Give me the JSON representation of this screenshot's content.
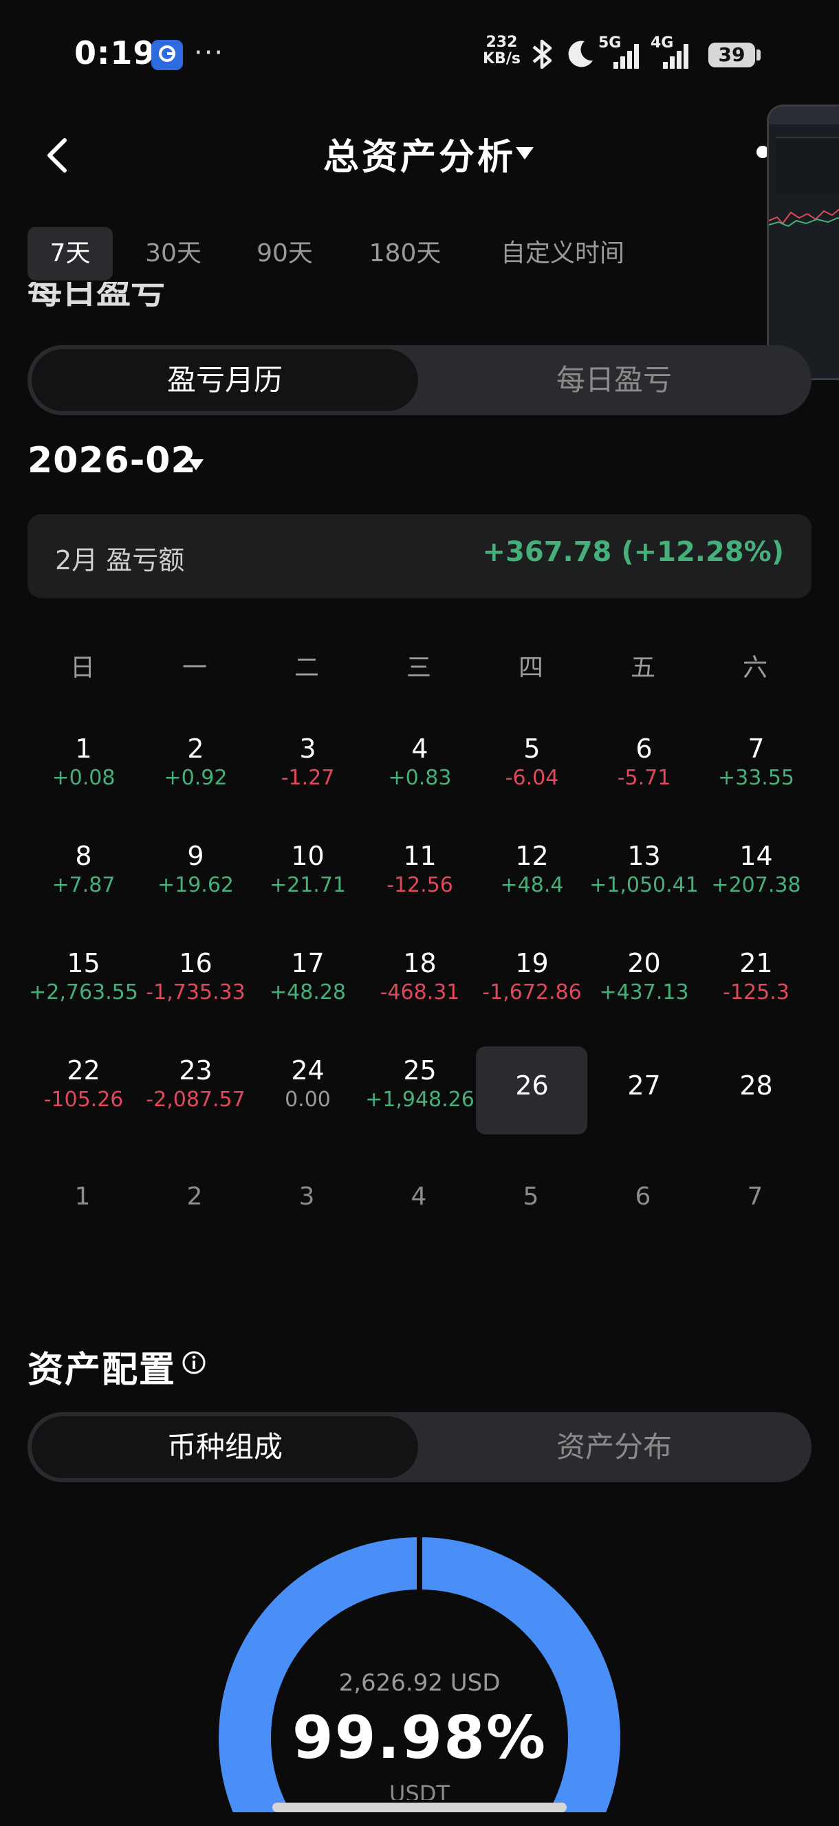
{
  "status_bar": {
    "time": "0:19",
    "more": "···",
    "net_speed_value": "232",
    "net_speed_unit": "KB/s",
    "sig1_label": "5G",
    "sig2_label": "4G",
    "battery": "39"
  },
  "header": {
    "title": "总资产分析"
  },
  "period_tabs": [
    "7天",
    "30天",
    "90天",
    "180天",
    "自定义时间"
  ],
  "daily_pnl_section_title": "每日盈亏",
  "pnl_toggle": {
    "calendar": "盈亏月历",
    "daily": "每日盈亏"
  },
  "month_selector": "2026-02",
  "summary": {
    "label": "2月 盈亏额",
    "value": "+367.78 (+12.28%)"
  },
  "weekdays": [
    "日",
    "一",
    "二",
    "三",
    "四",
    "五",
    "六"
  ],
  "calendar": [
    {
      "day": "1",
      "value": "+0.08",
      "trend": "pos"
    },
    {
      "day": "2",
      "value": "+0.92",
      "trend": "pos"
    },
    {
      "day": "3",
      "value": "-1.27",
      "trend": "neg"
    },
    {
      "day": "4",
      "value": "+0.83",
      "trend": "pos"
    },
    {
      "day": "5",
      "value": "-6.04",
      "trend": "neg"
    },
    {
      "day": "6",
      "value": "-5.71",
      "trend": "neg"
    },
    {
      "day": "7",
      "value": "+33.55",
      "trend": "pos"
    },
    {
      "day": "8",
      "value": "+7.87",
      "trend": "pos"
    },
    {
      "day": "9",
      "value": "+19.62",
      "trend": "pos"
    },
    {
      "day": "10",
      "value": "+21.71",
      "trend": "pos"
    },
    {
      "day": "11",
      "value": "-12.56",
      "trend": "neg"
    },
    {
      "day": "12",
      "value": "+48.4",
      "trend": "pos"
    },
    {
      "day": "13",
      "value": "+1,050.41",
      "trend": "pos"
    },
    {
      "day": "14",
      "value": "+207.38",
      "trend": "pos"
    },
    {
      "day": "15",
      "value": "+2,763.55",
      "trend": "pos"
    },
    {
      "day": "16",
      "value": "-1,735.33",
      "trend": "neg"
    },
    {
      "day": "17",
      "value": "+48.28",
      "trend": "pos"
    },
    {
      "day": "18",
      "value": "-468.31",
      "trend": "neg"
    },
    {
      "day": "19",
      "value": "-1,672.86",
      "trend": "neg"
    },
    {
      "day": "20",
      "value": "+437.13",
      "trend": "pos"
    },
    {
      "day": "21",
      "value": "-125.3",
      "trend": "neg"
    },
    {
      "day": "22",
      "value": "-105.26",
      "trend": "neg"
    },
    {
      "day": "23",
      "value": "-2,087.57",
      "trend": "neg"
    },
    {
      "day": "24",
      "value": "0.00",
      "trend": "zero"
    },
    {
      "day": "25",
      "value": "+1,948.26",
      "trend": "pos"
    },
    {
      "day": "26",
      "value": "",
      "trend": "today"
    },
    {
      "day": "27",
      "value": "",
      "trend": "none"
    },
    {
      "day": "28",
      "value": "",
      "trend": "none"
    }
  ],
  "next_month_days": [
    "1",
    "2",
    "3",
    "4",
    "5",
    "6",
    "7"
  ],
  "allocation": {
    "title": "资产配置",
    "toggle": {
      "coins": "币种组成",
      "distribution": "资产分布"
    },
    "total_amount": "2,626.92 USD",
    "top_share_pct": "99.98%",
    "top_coin": "USDT"
  },
  "colors": {
    "background": "#0b0b0c",
    "positive": "#46b07a",
    "negative": "#e0485c",
    "donut_blue": "#4a8ff7"
  }
}
